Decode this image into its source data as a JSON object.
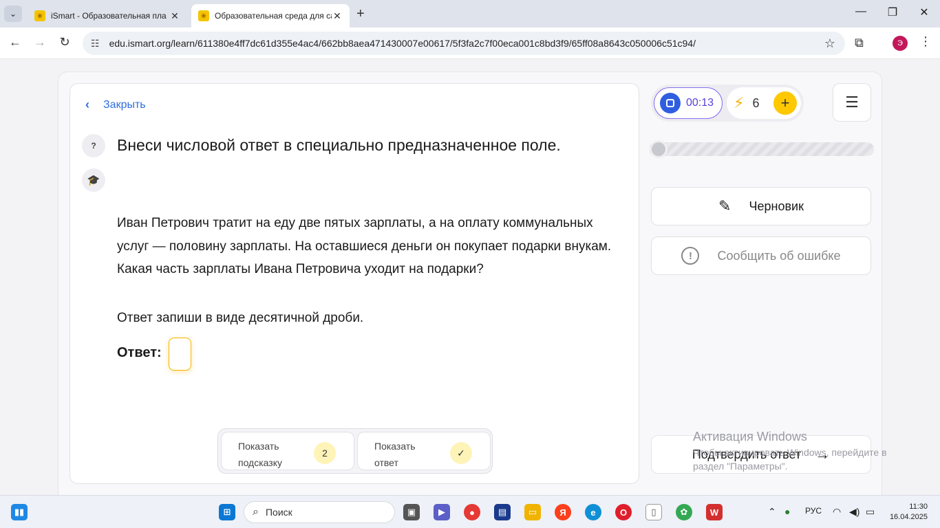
{
  "browser": {
    "tabs": [
      {
        "title": "iSmart - Образовательная пла",
        "active": false
      },
      {
        "title": "Образовательная среда для са",
        "active": true
      }
    ],
    "new_tab": "+",
    "url": "edu.ismart.org/learn/611380e4ff7dc61d355e4ac4/662bb8aea471430007e00617/5f3fa2c7f00eca001c8bd3f9/65ff08a8643c050006c51c94/",
    "profile_initial": "Э"
  },
  "lesson": {
    "close_label": "Закрыть",
    "help_badge": "?",
    "title": "Внеси числовой ответ в специально предназначенное поле.",
    "problem": "Иван Петрович тратит на еду две пятых зарплаты, а на оплату коммунальных услуг — половину зарплаты. На оставшиеся деньги он покупает подарки внукам. Какая часть зарплаты Ивана Петровича уходит на подарки?",
    "note": "Ответ запиши в виде десятичной дроби.",
    "answer_label": "Ответ:",
    "answer_value": "",
    "hint_button": {
      "line1": "Показать",
      "line2": "подсказку",
      "count": "2"
    },
    "answer_button": {
      "line1": "Показать",
      "line2": "ответ"
    }
  },
  "sidebar": {
    "timer": "00:13",
    "energy": "6",
    "energy_plus": "+",
    "progress_fraction": 0.05,
    "draft_label": "Черновик",
    "report_label": "Сообщить об ошибке",
    "submit_label": "Подтвердить ответ"
  },
  "watermark": {
    "line1": "Активация Windows",
    "line2": "Чтобы активировать Windows, перейдите в раздел \"Параметры\"."
  },
  "taskbar": {
    "search_placeholder": "Поиск",
    "language": "РУС",
    "time": "11:30",
    "date": "16.04.2025"
  },
  "colors": {
    "accent_blue": "#2f6fe0",
    "timer_purple": "#5a3fd8",
    "energy_yellow": "#ffc800",
    "input_border": "#f5b400"
  }
}
